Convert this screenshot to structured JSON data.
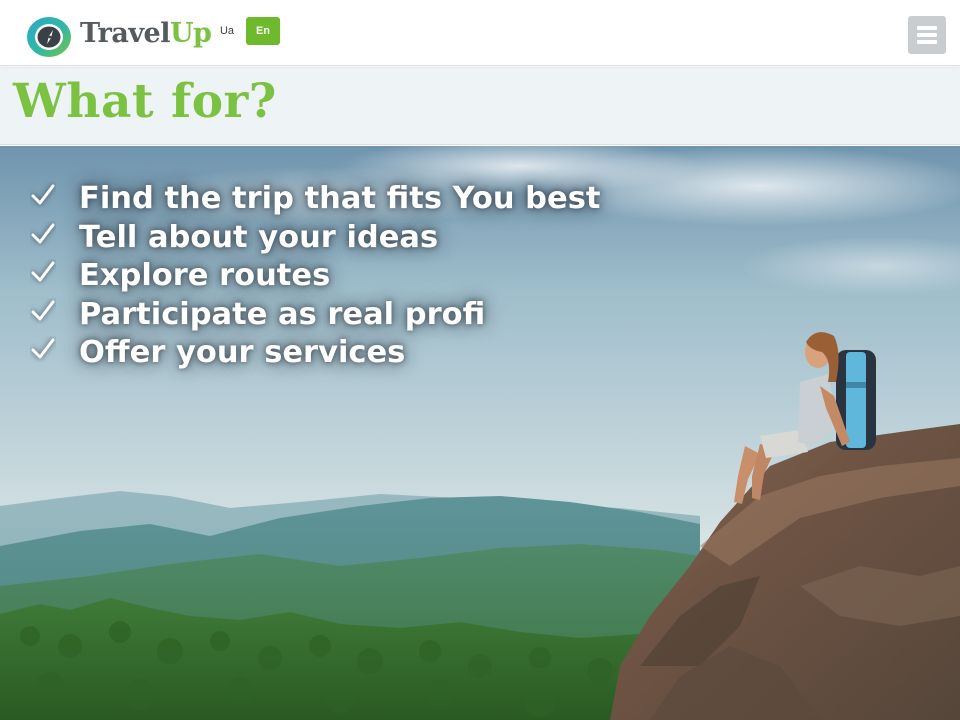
{
  "header": {
    "logo_icon": "compass-icon",
    "brand_part1": "Travel",
    "brand_part2": "Up",
    "lang_ua": "Ua",
    "lang_en": "En",
    "active_lang": "En",
    "menu_icon": "hamburger-menu-icon",
    "accent_color": "#7cc242"
  },
  "section": {
    "title": "What for?"
  },
  "benefits": [
    {
      "text": "Find the trip that fits You best",
      "icon": "checkmark-icon"
    },
    {
      "text": "Tell about your ideas",
      "icon": "checkmark-icon"
    },
    {
      "text": "Explore routes",
      "icon": "checkmark-icon"
    },
    {
      "text": "Participate as real profi",
      "icon": "checkmark-icon"
    },
    {
      "text": "Offer your services",
      "icon": "checkmark-icon"
    }
  ],
  "hero": {
    "image": "woman-with-backpack-on-cliff-over-forest-valley"
  }
}
